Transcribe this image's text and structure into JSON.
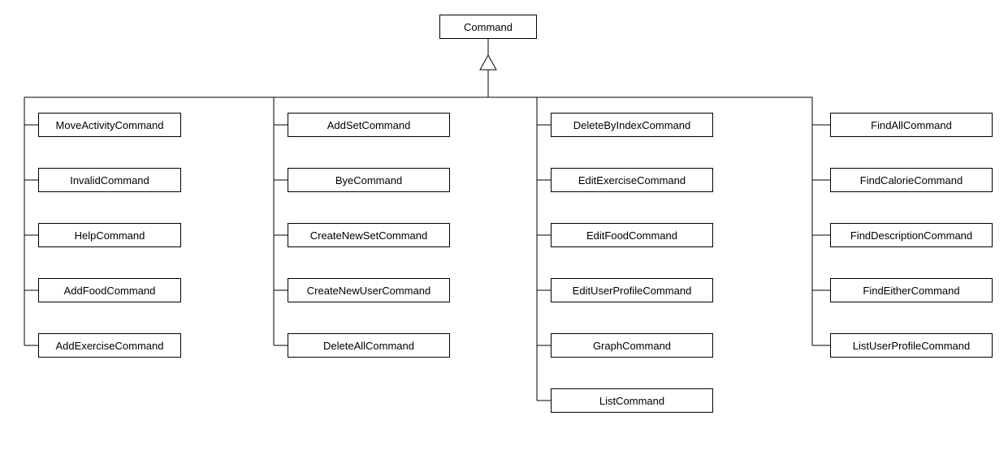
{
  "root": {
    "label": "Command"
  },
  "columns": [
    {
      "items": [
        {
          "label": "MoveActivityCommand"
        },
        {
          "label": "InvalidCommand"
        },
        {
          "label": "HelpCommand"
        },
        {
          "label": "AddFoodCommand"
        },
        {
          "label": "AddExerciseCommand"
        }
      ]
    },
    {
      "items": [
        {
          "label": "AddSetCommand"
        },
        {
          "label": "ByeCommand"
        },
        {
          "label": "CreateNewSetCommand"
        },
        {
          "label": "CreateNewUserCommand"
        },
        {
          "label": "DeleteAllCommand"
        }
      ]
    },
    {
      "items": [
        {
          "label": "DeleteByIndexCommand"
        },
        {
          "label": "EditExerciseCommand"
        },
        {
          "label": "EditFoodCommand"
        },
        {
          "label": "EditUserProfileCommand"
        },
        {
          "label": "GraphCommand"
        },
        {
          "label": "ListCommand"
        }
      ]
    },
    {
      "items": [
        {
          "label": "FindAllCommand"
        },
        {
          "label": "FindCalorieCommand"
        },
        {
          "label": "FindDescriptionCommand"
        },
        {
          "label": "FindEitherCommand"
        },
        {
          "label": "ListUserProfileCommand"
        }
      ]
    }
  ]
}
